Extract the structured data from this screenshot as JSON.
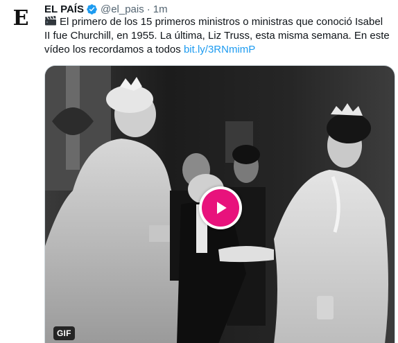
{
  "tweet": {
    "author_name": "EL PAÍS",
    "handle": "@el_pais",
    "separator": "·",
    "time": "1m",
    "avatar_letter": "E",
    "text_main": "El primero de los 15 primeros ministros o ministras que conoció Isabel II fue Churchill, en 1955. La última, Liz Truss, esta misma semana. En este vídeo los recordamos a todos ",
    "link": "bit.ly/3RNmimP",
    "media": {
      "badge": "GIF",
      "play_color": "#e8127c"
    },
    "icons": {
      "avatar": "el-pais-logo",
      "verified": "verified-badge-icon",
      "emoji": "clapper-board-icon",
      "play": "play-icon"
    },
    "colors": {
      "link": "#1d9bf0",
      "verified": "#1d9bf0",
      "muted": "#536471"
    }
  }
}
